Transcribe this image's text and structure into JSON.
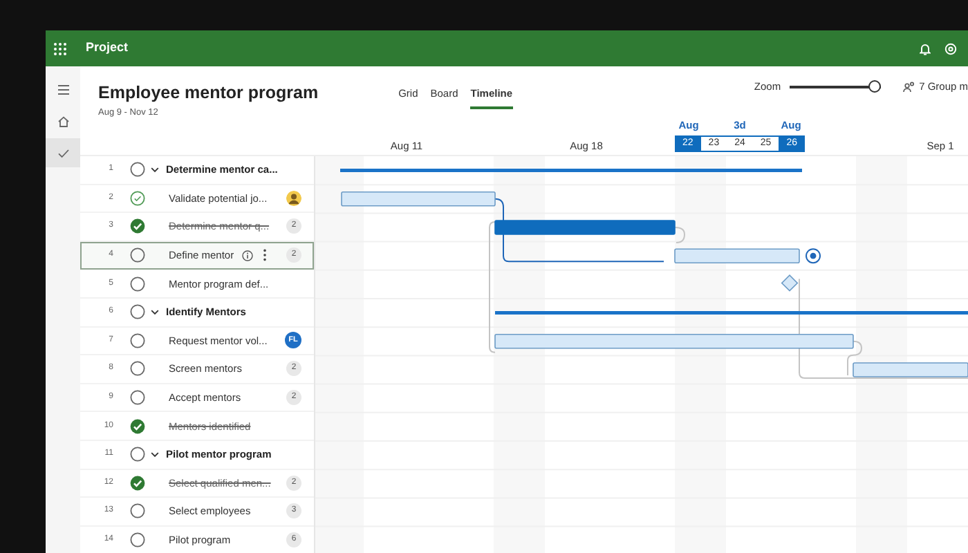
{
  "app_bar": {
    "title": "Project"
  },
  "rail": [
    {
      "kind": "menu",
      "selected": false
    },
    {
      "kind": "home",
      "selected": false
    },
    {
      "kind": "check",
      "selected": true
    }
  ],
  "plan": {
    "title": "Employee mentor program",
    "dates": "Aug 9 - Nov 12"
  },
  "tabs": [
    {
      "label": "Grid",
      "selected": false
    },
    {
      "label": "Board",
      "selected": false
    },
    {
      "label": "Timeline",
      "selected": true
    }
  ],
  "zoom": {
    "label": "Zoom",
    "level": 1
  },
  "group_button": {
    "label": "7 Group m"
  },
  "timeline_header": {
    "week_labels": [
      "Aug 11",
      "Aug 18",
      "Sep 1"
    ],
    "range_labels": [
      "Aug",
      "3d",
      "Aug"
    ],
    "range_days": [
      {
        "label": "22",
        "highlighted": true
      },
      {
        "label": "23",
        "highlighted": false
      },
      {
        "label": "24",
        "highlighted": false
      },
      {
        "label": "25",
        "highlighted": false
      },
      {
        "label": "26",
        "highlighted": true
      }
    ]
  },
  "tasks": [
    {
      "number": "1",
      "completed": false,
      "started": false,
      "name": "Determine mentor ca...",
      "summary": true,
      "selected": false
    },
    {
      "number": "2",
      "completed": false,
      "started": true,
      "name": "Validate potential jo...",
      "summary": false,
      "selected": false,
      "assignee": {
        "kind": "avatar"
      }
    },
    {
      "number": "3",
      "completed": true,
      "started": true,
      "name": "Determine mentor q...",
      "summary": false,
      "selected": false,
      "assignee": {
        "kind": "count",
        "text": "2"
      }
    },
    {
      "number": "4",
      "completed": false,
      "started": false,
      "name": "Define mentor",
      "summary": false,
      "selected": true,
      "assignee": {
        "kind": "count",
        "text": "2"
      }
    },
    {
      "number": "5",
      "completed": false,
      "started": false,
      "name": "Mentor program def...",
      "summary": false,
      "selected": false
    },
    {
      "number": "6",
      "completed": false,
      "started": false,
      "name": "Identify Mentors",
      "summary": true,
      "selected": false
    },
    {
      "number": "7",
      "completed": false,
      "started": false,
      "name": "Request mentor vol...",
      "summary": false,
      "selected": false,
      "assignee": {
        "kind": "initials",
        "text": "FL"
      }
    },
    {
      "number": "8",
      "completed": false,
      "started": false,
      "name": "Screen mentors",
      "summary": false,
      "selected": false,
      "assignee": {
        "kind": "count",
        "text": "2"
      }
    },
    {
      "number": "9",
      "completed": false,
      "started": false,
      "name": "Accept mentors",
      "summary": false,
      "selected": false,
      "assignee": {
        "kind": "count",
        "text": "2"
      }
    },
    {
      "number": "10",
      "completed": true,
      "started": true,
      "name": "Mentors identified",
      "summary": false,
      "selected": false
    },
    {
      "number": "11",
      "completed": false,
      "started": false,
      "name": "Pilot mentor program",
      "summary": true,
      "selected": false
    },
    {
      "number": "12",
      "completed": true,
      "started": true,
      "name": "Select qualified men...",
      "summary": false,
      "selected": false,
      "assignee": {
        "kind": "count",
        "text": "2"
      }
    },
    {
      "number": "13",
      "completed": false,
      "started": false,
      "name": "Select employees",
      "summary": false,
      "selected": false,
      "assignee": {
        "kind": "count",
        "text": "3"
      }
    },
    {
      "number": "14",
      "completed": false,
      "started": false,
      "name": "Pilot program",
      "summary": false,
      "selected": false,
      "assignee": {
        "kind": "count",
        "text": "6"
      }
    }
  ]
}
